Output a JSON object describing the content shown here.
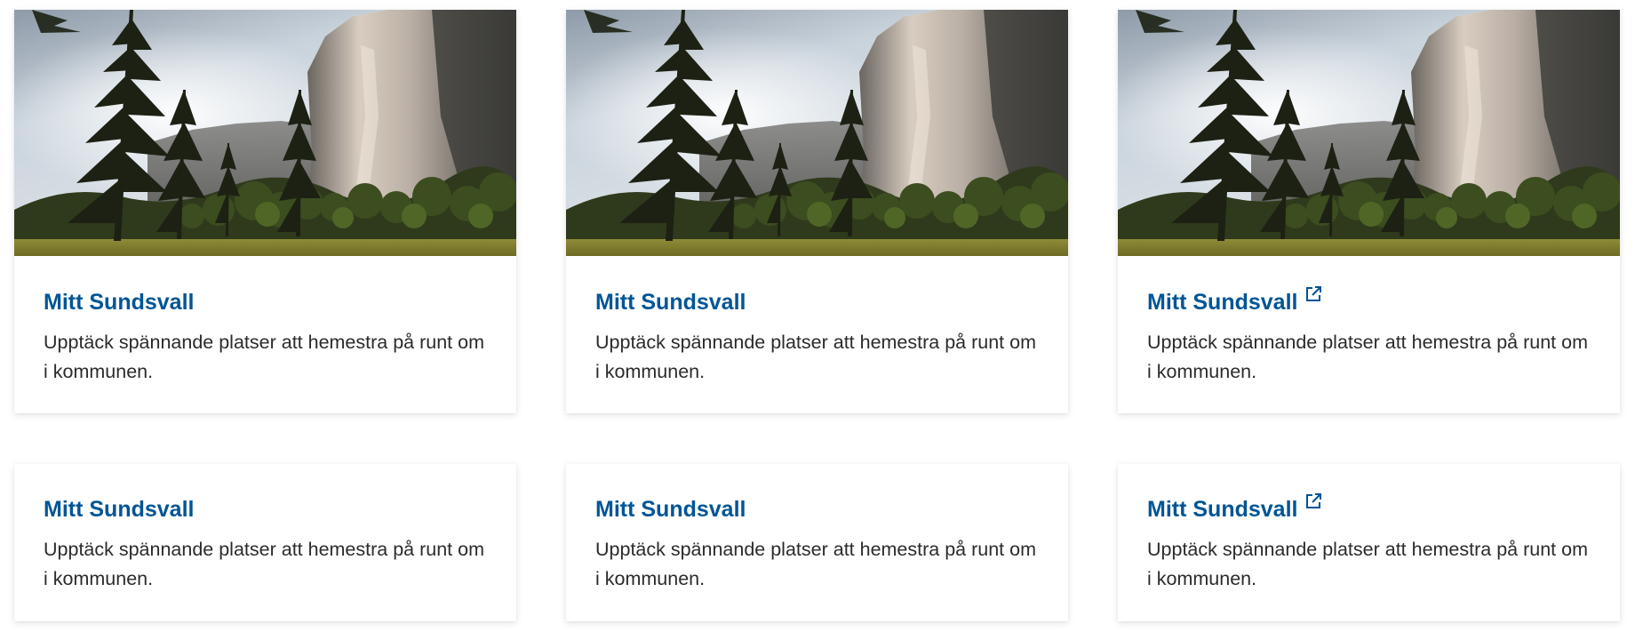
{
  "colors": {
    "title": "#005595",
    "text": "#2b2b2b",
    "background": "#ffffff"
  },
  "cards": [
    {
      "title": "Mitt Sundsvall",
      "description": "Upptäck spännande platser att hemestra på runt om i kommunen.",
      "has_image": true,
      "image_alt": "Yosemite valley with El Capitan and pine trees",
      "external": false
    },
    {
      "title": "Mitt Sundsvall",
      "description": "Upptäck spännande platser att hemestra på runt om i kommunen.",
      "has_image": true,
      "image_alt": "Yosemite valley with El Capitan and pine trees",
      "external": false
    },
    {
      "title": "Mitt Sundsvall",
      "description": "Upptäck spännande platser att hemestra på runt om i kommunen.",
      "has_image": true,
      "image_alt": "Yosemite valley with El Capitan and pine trees",
      "external": true,
      "external_icon": "external-link-icon"
    },
    {
      "title": "Mitt Sundsvall",
      "description": "Upptäck spännande platser att hemestra på runt om i kommunen.",
      "has_image": false,
      "external": false
    },
    {
      "title": "Mitt Sundsvall",
      "description": "Upptäck spännande platser att hemestra på runt om i kommunen.",
      "has_image": false,
      "external": false
    },
    {
      "title": "Mitt Sundsvall",
      "description": "Upptäck spännande platser att hemestra på runt om i kommunen.",
      "has_image": false,
      "external": true,
      "external_icon": "external-link-icon"
    }
  ]
}
